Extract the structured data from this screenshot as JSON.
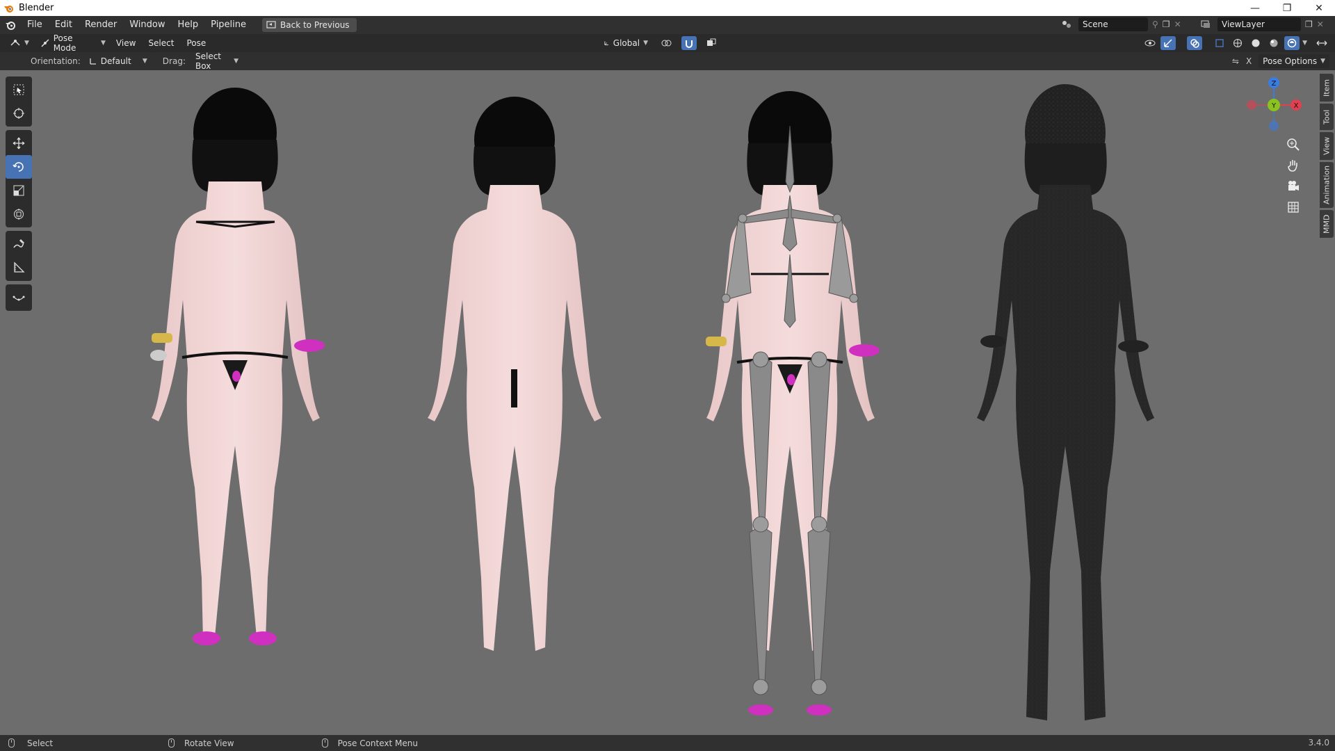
{
  "window": {
    "title": "Blender",
    "controls": [
      "minimize-icon",
      "restore-icon",
      "close-icon"
    ]
  },
  "topbar": {
    "menus": [
      "File",
      "Edit",
      "Render",
      "Window",
      "Help",
      "Pipeline"
    ],
    "back_button": "Back to Previous",
    "scene": "Scene",
    "view_layer": "ViewLayer"
  },
  "header": {
    "mode": "Pose Mode",
    "menus": [
      "View",
      "Select",
      "Pose"
    ],
    "transform_orientation": "Global"
  },
  "tool_settings": {
    "orientation_label": "Orientation:",
    "orientation_value": "Default",
    "drag_label": "Drag:",
    "drag_value": "Select Box",
    "pose_options": "Pose Options"
  },
  "toolbar": {
    "tools": [
      "select-box-icon",
      "cursor-icon",
      "move-icon",
      "rotate-icon",
      "scale-icon",
      "transform-icon",
      "annotate-icon",
      "measure-icon",
      "relax-icon"
    ],
    "active_tool": "rotate-icon"
  },
  "sidebar_tabs": [
    "Item",
    "Tool",
    "View",
    "Animation",
    "MMD"
  ],
  "gizmo": {
    "axes": [
      "Z",
      "Y",
      "X"
    ]
  },
  "statusbar": {
    "items": [
      "Select",
      "Rotate View",
      "Pose Context Menu"
    ],
    "version": "3.4.0"
  },
  "colors": {
    "accent": "#4772b3",
    "x_axis": "#e04050",
    "y_axis": "#8ac21f",
    "z_axis": "#3a7ce0"
  }
}
